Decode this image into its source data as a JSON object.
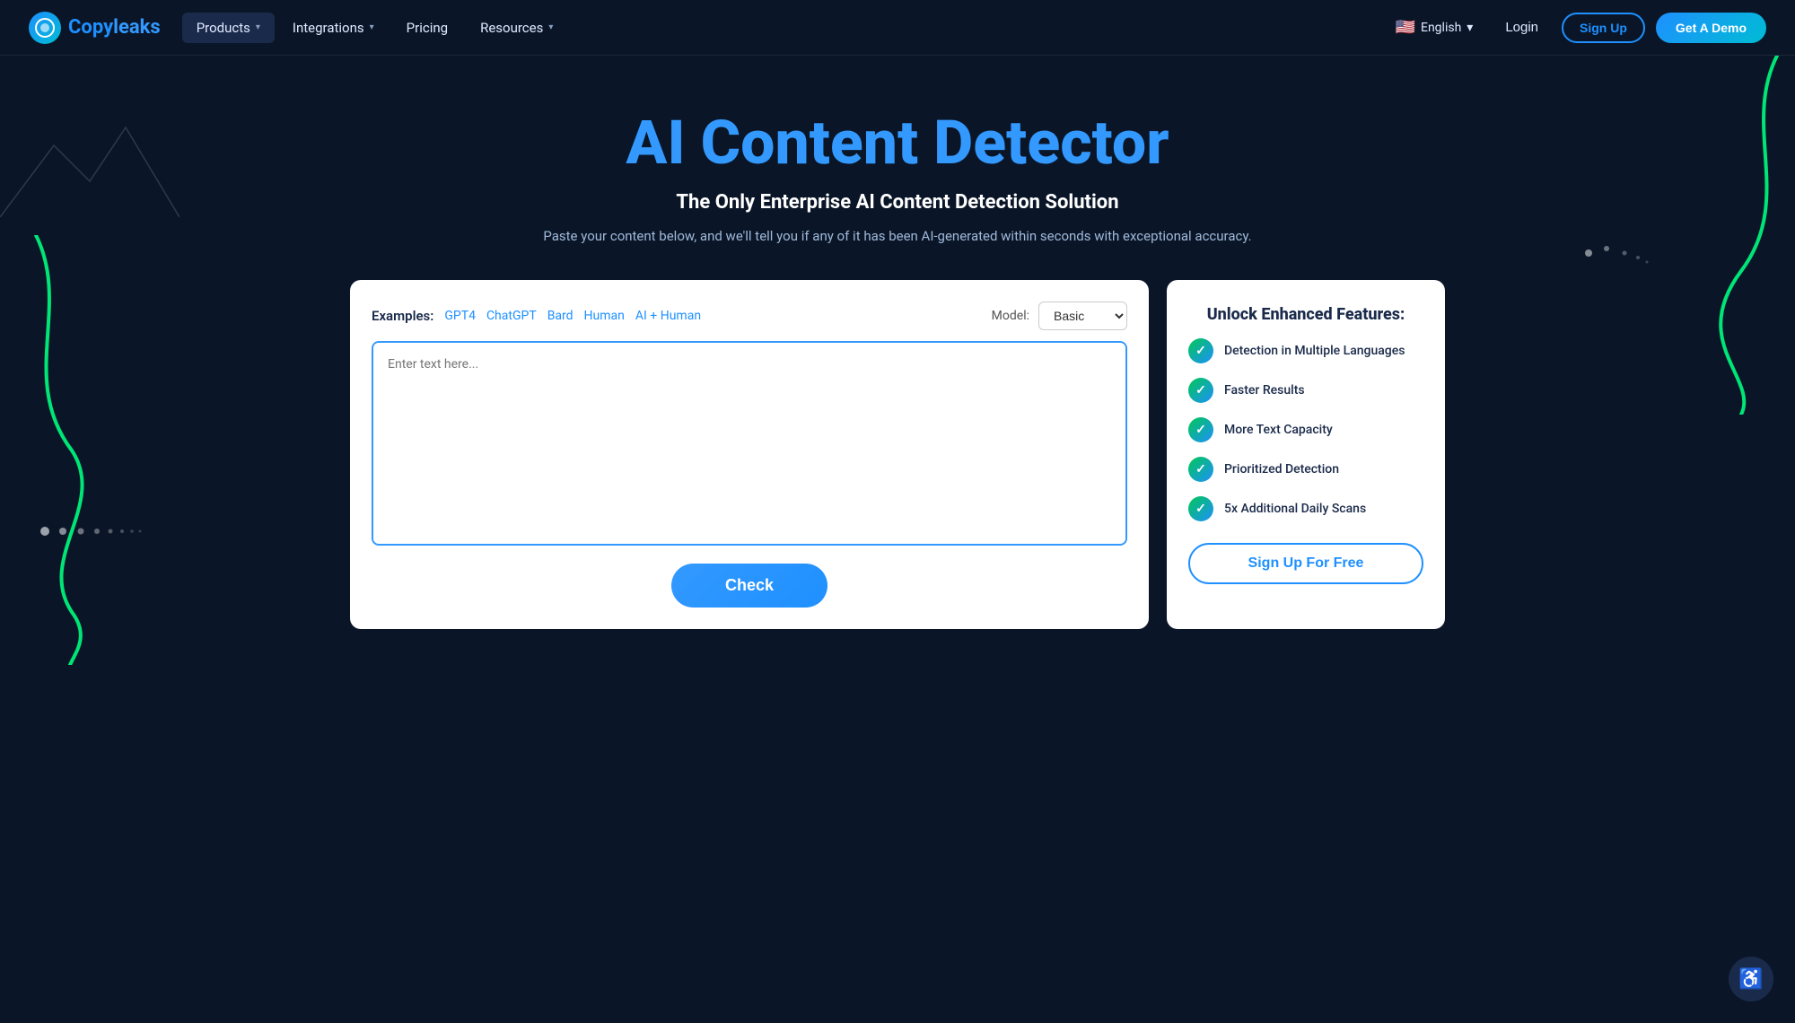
{
  "logo": {
    "icon_char": "C",
    "name_prefix": "Copy",
    "name_suffix": "leaks"
  },
  "navbar": {
    "products_label": "Products",
    "integrations_label": "Integrations",
    "pricing_label": "Pricing",
    "resources_label": "Resources",
    "language": "English",
    "login_label": "Login",
    "signup_label": "Sign Up",
    "demo_label": "Get A Demo"
  },
  "hero": {
    "title": "AI Content Detector",
    "subtitle": "The Only Enterprise AI Content Detection Solution",
    "description": "Paste your content below, and we'll tell you if any of it has been AI-generated within seconds with exceptional accuracy."
  },
  "detector": {
    "examples_label": "Examples:",
    "example_links": [
      "GPT4",
      "ChatGPT",
      "Bard",
      "Human",
      "AI + Human"
    ],
    "model_label": "Model:",
    "model_default": "Basic",
    "textarea_placeholder": "Enter text here...",
    "check_button": "Check"
  },
  "features": {
    "title": "Unlock Enhanced Features:",
    "items": [
      "Detection in Multiple Languages",
      "Faster Results",
      "More Text Capacity",
      "Prioritized Detection",
      "5x Additional Daily Scans"
    ],
    "signup_button": "Sign Up For Free"
  }
}
